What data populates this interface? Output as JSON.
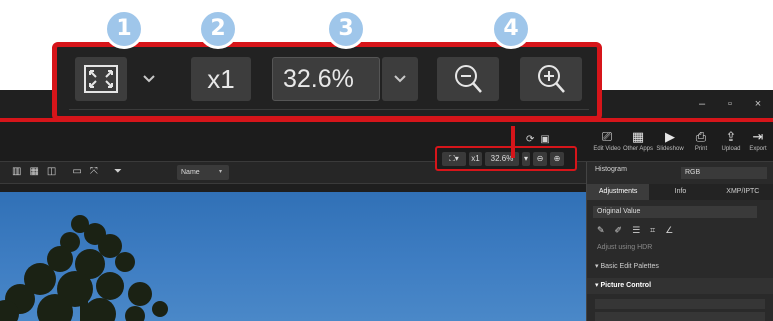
{
  "window": {
    "minimize_icon": "–",
    "maximize_icon": "▫",
    "close_icon": "×"
  },
  "toolbar": {
    "items": [
      {
        "label": "Edit Video",
        "icon": "edit-video"
      },
      {
        "label": "Other Apps",
        "icon": "apps"
      },
      {
        "label": "Slideshow",
        "icon": "slideshow"
      },
      {
        "label": "Print",
        "icon": "print"
      },
      {
        "label": "Upload",
        "icon": "upload"
      },
      {
        "label": "Export",
        "icon": "export"
      }
    ]
  },
  "viewbar": {
    "sort_label": "Name"
  },
  "zoom_callout": {
    "badges": [
      "1",
      "2",
      "3",
      "4"
    ],
    "actual_size_label": "x1",
    "zoom_value": "32.6%",
    "accent_color": "#d6151a",
    "badge_color": "#9fc6ea"
  },
  "mini_zoom": {
    "actual_size_label": "x1",
    "zoom_value": "32.6%"
  },
  "right_panel": {
    "histogram_label": "Histogram",
    "channel_value": "RGB",
    "tabs": [
      "Adjustments",
      "Info",
      "XMP/IPTC"
    ],
    "preset_value": "Original Value",
    "hdr_label": "Adjust using HDR",
    "basic_edit_label": "Basic Edit Palettes",
    "picture_control_label": "Picture Control"
  }
}
